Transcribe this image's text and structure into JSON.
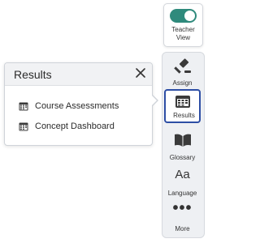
{
  "teacher_view": {
    "label_line1": "Teacher",
    "label_line2": "View",
    "enabled": true,
    "toggle_color": "#2f8a7c"
  },
  "tools": [
    {
      "label": "Assign",
      "icon": "gavel-icon"
    },
    {
      "label": "Results",
      "icon": "calendar-table-icon",
      "active": true
    },
    {
      "label": "Glossary",
      "icon": "book-icon"
    },
    {
      "label": "Language",
      "icon": "text-aa-icon",
      "glyph": "Aa"
    },
    {
      "label": "More",
      "icon": "more-dots-icon",
      "glyph": "•••"
    }
  ],
  "popover": {
    "title": "Results",
    "items": [
      {
        "label": "Course Assessments",
        "icon": "calendar-table-icon"
      },
      {
        "label": "Concept Dashboard",
        "icon": "calendar-table-icon"
      }
    ]
  },
  "colors": {
    "accent": "#2d4ea5",
    "toggle": "#2f8a7c",
    "panel_bg": "#eef0f3"
  }
}
